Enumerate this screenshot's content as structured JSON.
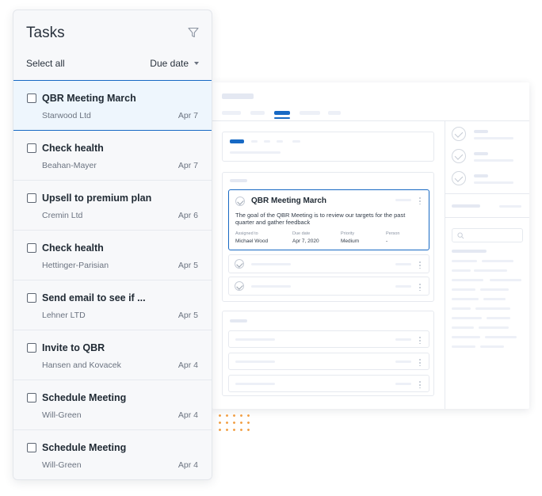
{
  "panel": {
    "title": "Tasks",
    "select_all": "Select all",
    "sort_label": "Due date",
    "tasks": [
      {
        "name": "QBR Meeting March",
        "company": "Starwood Ltd",
        "date": "Apr 7",
        "selected": true
      },
      {
        "name": "Check health",
        "company": "Beahan-Mayer",
        "date": "Apr 7"
      },
      {
        "name": "Upsell to premium plan",
        "company": "Cremin Ltd",
        "date": "Apr 6"
      },
      {
        "name": "Check health",
        "company": "Hettinger-Parisian",
        "date": "Apr 5"
      },
      {
        "name": "Send email to see if ...",
        "company": "Lehner LTD",
        "date": "Apr 5"
      },
      {
        "name": "Invite to QBR",
        "company": "Hansen and Kovacek",
        "date": "Apr 4"
      },
      {
        "name": "Schedule Meeting",
        "company": "Will-Green",
        "date": "Apr 4"
      },
      {
        "name": "Schedule Meeting",
        "company": "Will-Green",
        "date": "Apr 4"
      }
    ]
  },
  "detail": {
    "title": "QBR Meeting March",
    "description": "The goal of the QBR Meeting is to review our targets for the past quarter and gather feedback",
    "fields": [
      {
        "label": "Assigned to",
        "value": "Michael Wood"
      },
      {
        "label": "Due date",
        "value": "Apr 7, 2020"
      },
      {
        "label": "Priority",
        "value": "Medium"
      },
      {
        "label": "Person",
        "value": "-"
      }
    ]
  },
  "icons": {
    "filter": "filter-icon",
    "sort": "caret-down-icon",
    "check": "check-circle-icon",
    "search": "search-icon"
  },
  "colors": {
    "accent": "#1769c4",
    "dots": "#f2a24a",
    "panel_bg": "#f7f8fa"
  }
}
